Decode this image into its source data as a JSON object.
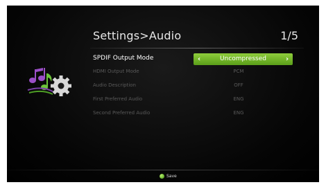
{
  "header": {
    "title": "Settings>Audio",
    "page_indicator": "1/5"
  },
  "app_icon": "music-notes-gear-icon",
  "settings": [
    {
      "label": "SPDIF Output Mode",
      "value": "Uncompressed",
      "selected": true
    },
    {
      "label": "HDMI Output Mode",
      "value": "PCM",
      "selected": false
    },
    {
      "label": "Audio Description",
      "value": "OFF",
      "selected": false
    },
    {
      "label": "First Preferred Audio",
      "value": "ENG",
      "selected": false
    },
    {
      "label": "Second Preferred Audio",
      "value": "ENG",
      "selected": false
    }
  ],
  "selector": {
    "left_arrow": "‹",
    "right_arrow": "›"
  },
  "footer": {
    "save_label": "Save",
    "save_key_icon": "green-button-icon"
  },
  "colors": {
    "accent": "#72b52a",
    "background": "#000000",
    "dim_text": "#5a5a5a"
  }
}
